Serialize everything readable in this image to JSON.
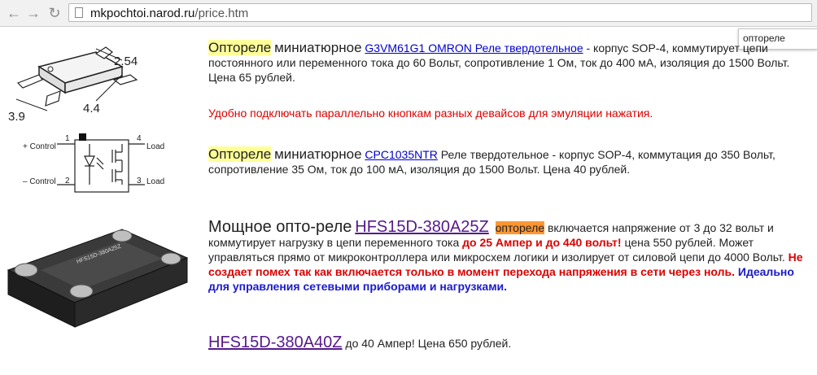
{
  "browser": {
    "url_host": "mkpochtoi.narod.ru",
    "url_path": "/price.htm",
    "find_query": "оптореле"
  },
  "item1": {
    "highlight": "Оптореле",
    "adj": "миниатюрное",
    "link": "G3VM61G1 OMRON Реле твердотельное",
    "desc": "- корпус SOP-4, коммутирует цепи постоянного или переменного тока до 60 Вольт, сопротивление 1 Ом, ток до 400 мА, изоляция до 1500 Вольт. Цена 65 рублей.",
    "note": "Удобно подключать параллельно кнопкам разных девайсов для эмуляции нажатия."
  },
  "item2": {
    "highlight": "Оптореле",
    "adj": "миниатюрное",
    "link": "CPC1035NTR",
    "desc": "Реле твердотельное - корпус SOP-4, коммутация до 350 Вольт, сопротивление 35 Ом, ток до 100 мА, изоляция до 1500 Вольт. Цена 40 рублей."
  },
  "item3": {
    "title": "Мощное опто-реле",
    "link": "HFS15D-380A25Z",
    "highlight": "оптореле",
    "text1": "включается напряжение от 3 до 32 вольт и коммутирует нагрузку в цепи  переменного тока",
    "red1": "до 25 Ампер и до 440 вольт!",
    "text2": "цена 550 рублей. Может управляться прямо от микроконтроллера или микросхем логики и изолирует от силовой цепи до 4000 Вольт.",
    "red2": "Не создает помех так как включается только в момент перехода напряжения в сети через ноль.",
    "blue": "Идеально для управления сетевыми приборами и нагрузками."
  },
  "item4": {
    "link": "HFS15D-380A40Z",
    "desc": "до 40 Ампер! Цена 650 рублей."
  },
  "diagram": {
    "dim_top": "2.54",
    "dim_left": "3.9",
    "dim_right": "4.4",
    "pin1": "1",
    "pin2": "2",
    "pin3": "3",
    "pin4": "4",
    "plus_control": "+ Control",
    "minus_control": "– Control",
    "load_top": "Load",
    "load_bottom": "Load"
  },
  "colors": {
    "find_highlight": "#ffff99",
    "active_find_highlight": "#ff9632",
    "link": "#0000cc",
    "visited_link": "#551a8b",
    "red_text": "#dd0000",
    "blue_text": "#1a1acc"
  }
}
